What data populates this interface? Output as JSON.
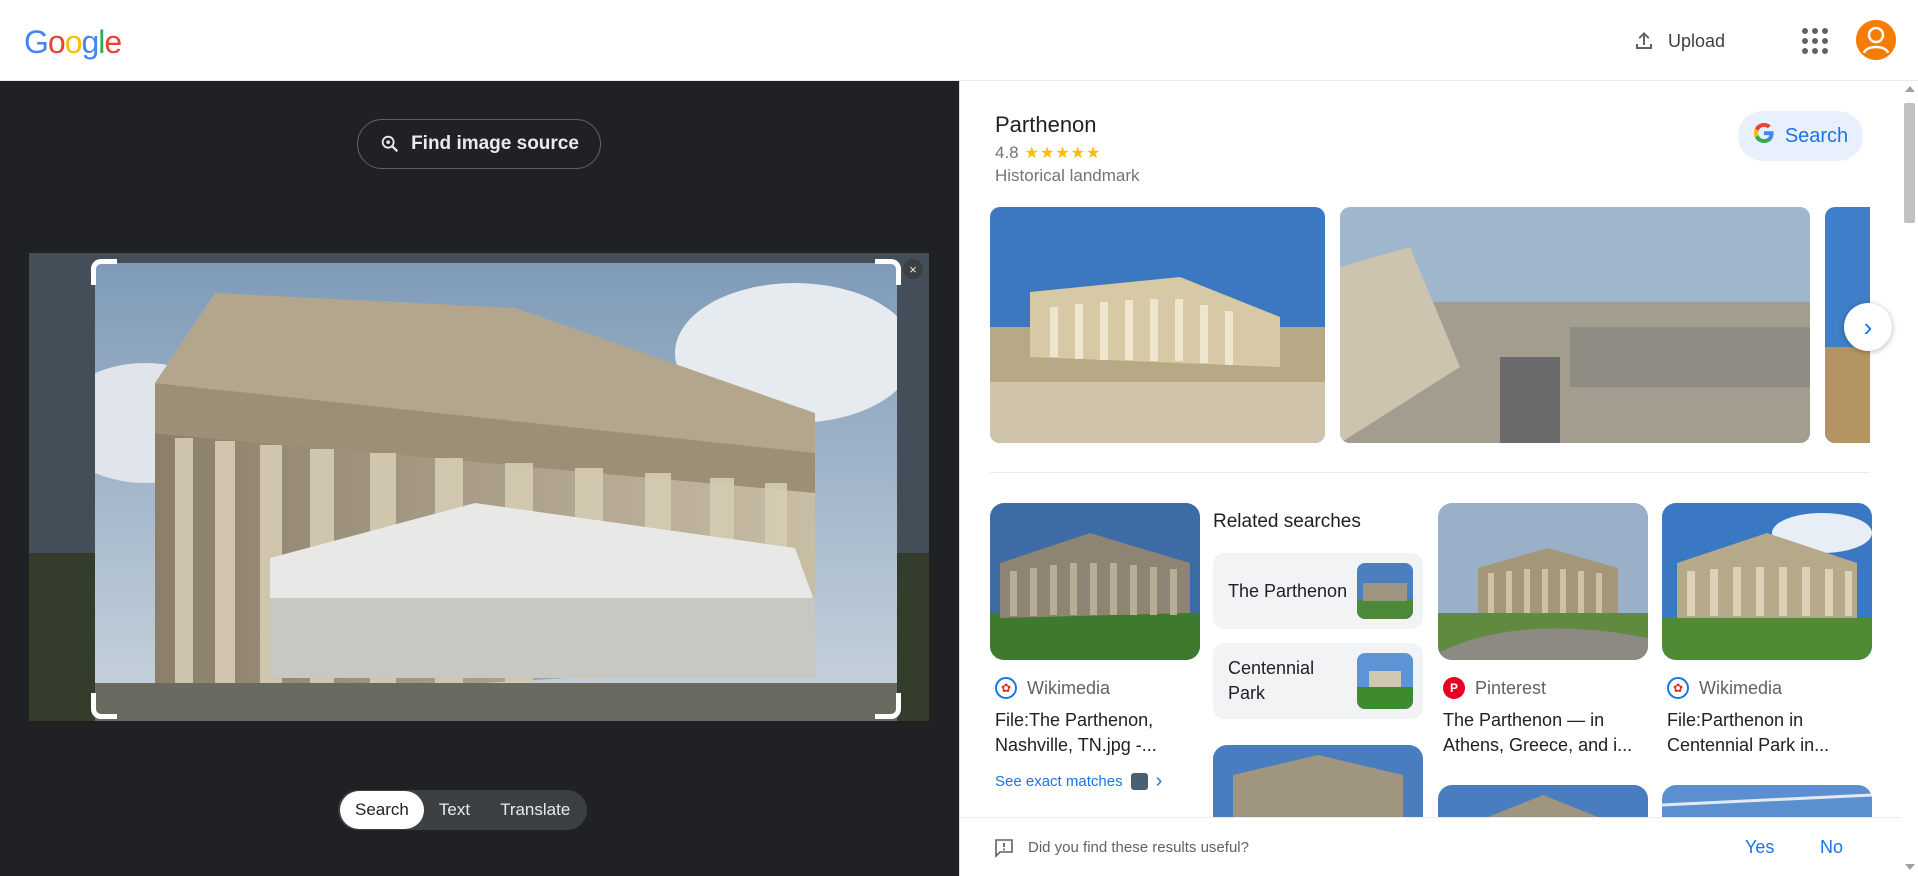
{
  "header": {
    "logo_letters": [
      "G",
      "o",
      "o",
      "g",
      "l",
      "e"
    ],
    "logo_colors": [
      "#4285f4",
      "#ea4335",
      "#fbbc05",
      "#4285f4",
      "#34a853",
      "#ea4335"
    ],
    "upload_label": "Upload"
  },
  "lens": {
    "find_source_label": "Find image source",
    "close_label": "×",
    "tabs": [
      {
        "label": "Search",
        "active": true
      },
      {
        "label": "Text",
        "active": false
      },
      {
        "label": "Translate",
        "active": false
      }
    ]
  },
  "knowledge_panel": {
    "title": "Parthenon",
    "rating": "4.8",
    "stars": "★★★★★",
    "type": "Historical landmark",
    "search_button": "Search",
    "google_g": "G"
  },
  "results": [
    {
      "source": "Wikimedia",
      "source_color": "#1a73e8",
      "title": "File:The Parthenon, Nashville, TN.jpg -..."
    },
    {
      "source": "Pinterest",
      "source_color": "#e60023",
      "title": "The Parthenon — in Athens, Greece, and i..."
    },
    {
      "source": "Wikimedia",
      "source_color": "#1a73e8",
      "title": "File:Parthenon in Centennial Park in..."
    }
  ],
  "exact_matches_label": "See exact matches",
  "related": {
    "title": "Related searches",
    "items": [
      {
        "label": "The Parthenon"
      },
      {
        "label": "Centennial Park"
      }
    ]
  },
  "feedback": {
    "question": "Did you find these results useful?",
    "yes": "Yes",
    "no": "No"
  },
  "icons": {
    "chevron_right": "›",
    "next_arrow": "›"
  },
  "colors": {
    "accent": "#1a73e8",
    "dark_panel": "#202124",
    "star": "#fbbc04"
  }
}
